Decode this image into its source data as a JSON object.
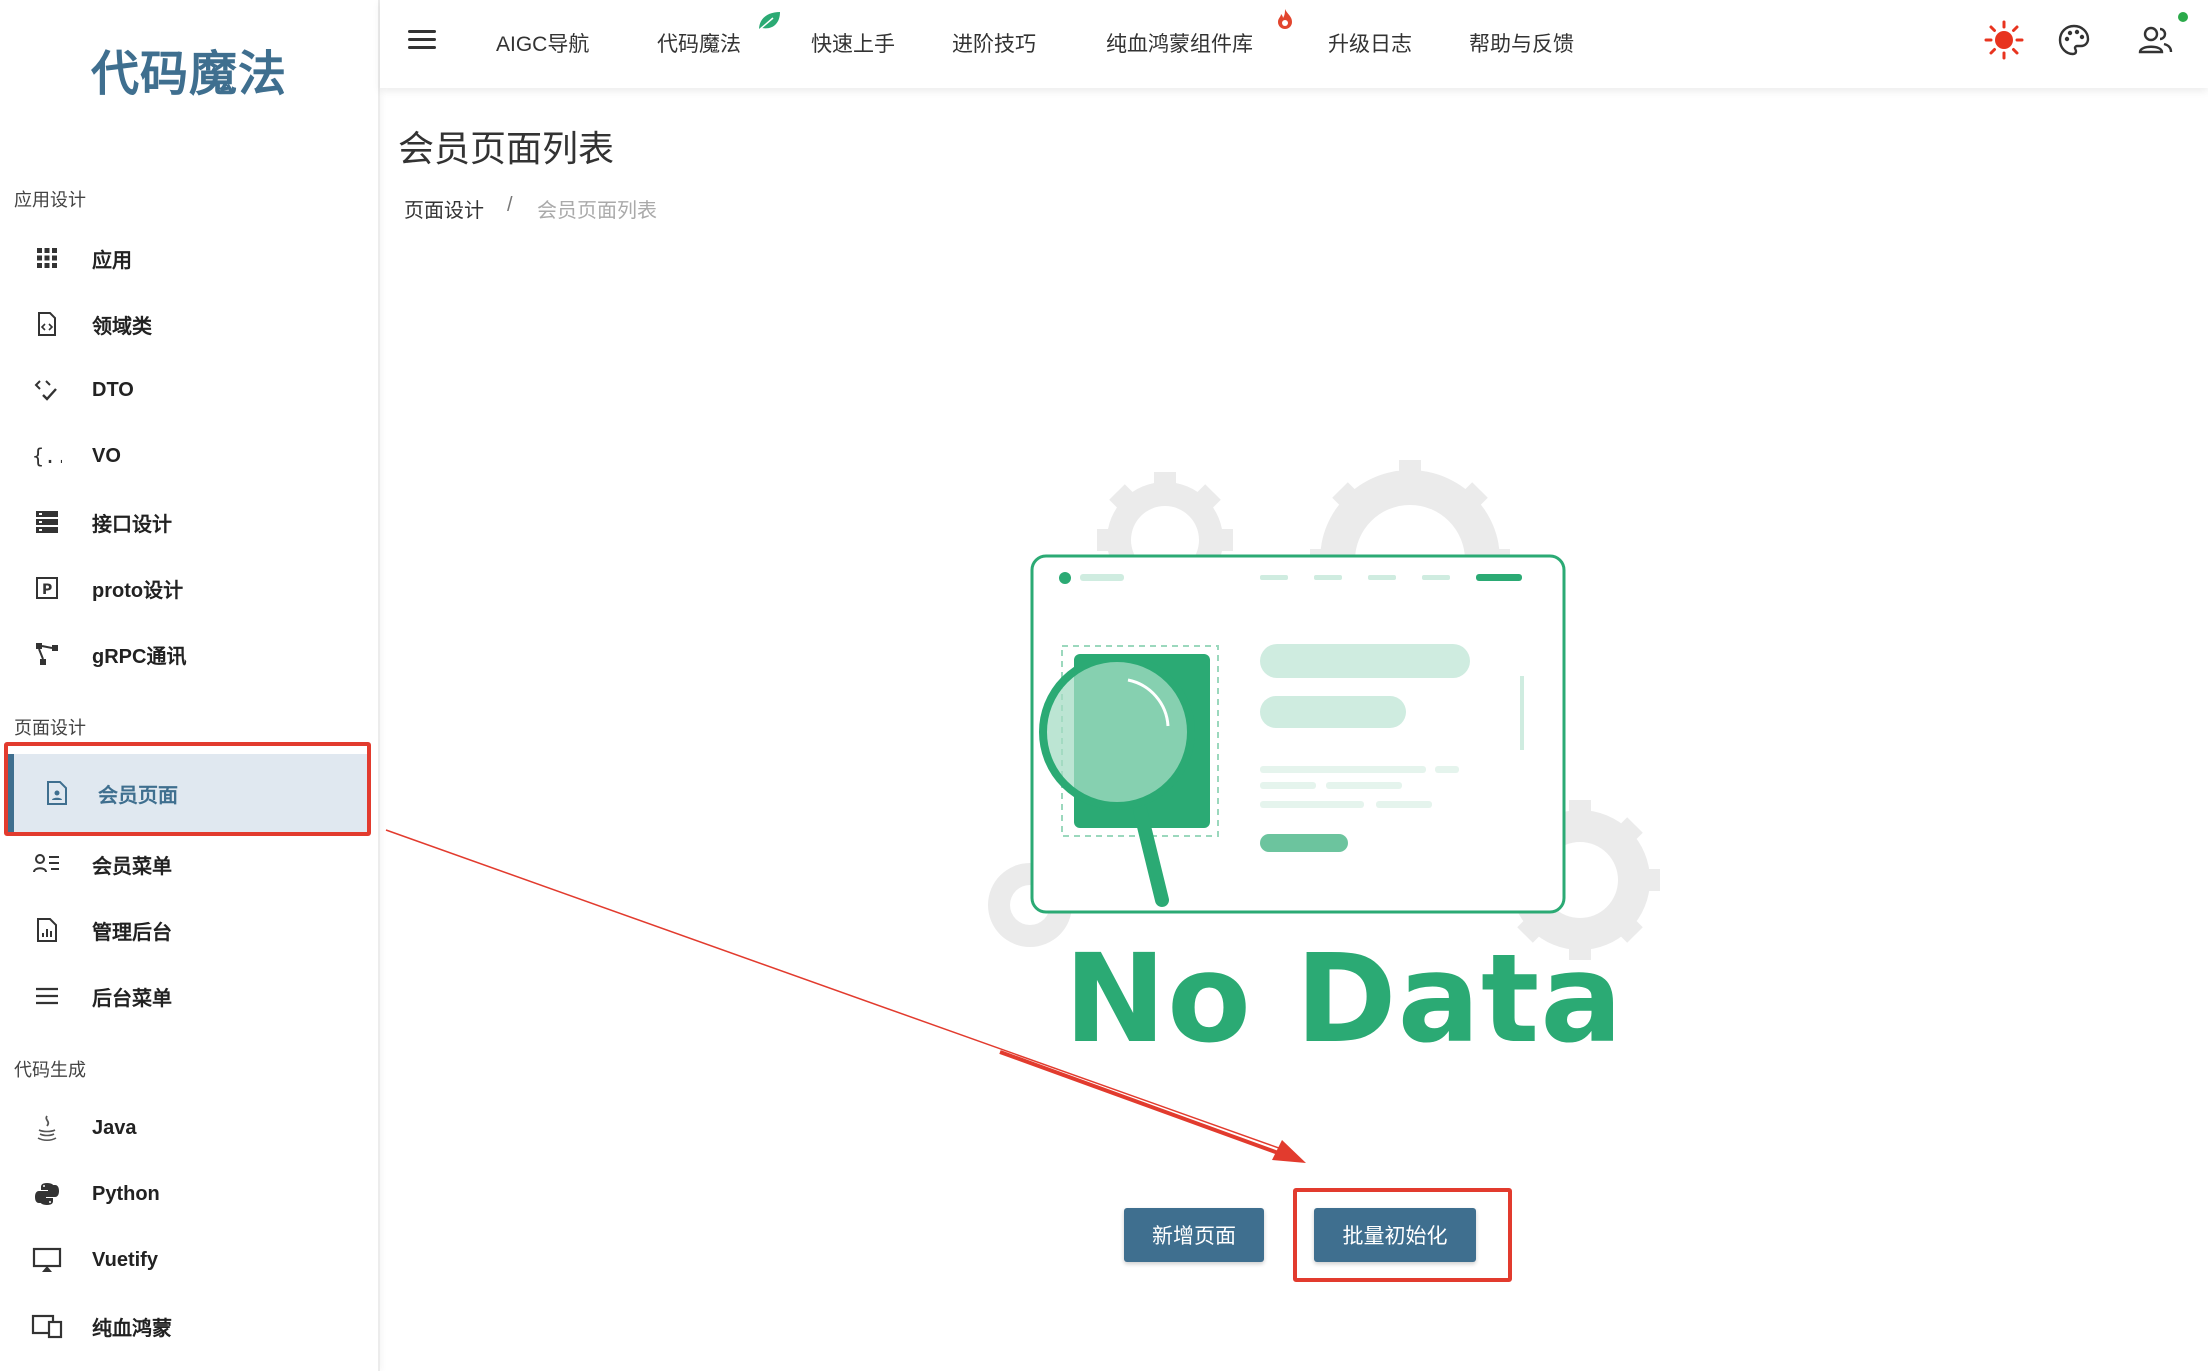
{
  "app": {
    "logo": "代码魔法"
  },
  "sidebar": {
    "sections": [
      {
        "title": "应用设计",
        "items": [
          {
            "label": "应用",
            "icon": "apps-grid-icon"
          },
          {
            "label": "领域类",
            "icon": "code-file-icon"
          },
          {
            "label": "DTO",
            "icon": "code-check-icon"
          },
          {
            "label": "VO",
            "icon": "braces-icon"
          },
          {
            "label": "接口设计",
            "icon": "server-icon"
          },
          {
            "label": "proto设计",
            "icon": "p-box-icon"
          },
          {
            "label": "gRPC通讯",
            "icon": "connection-icon"
          }
        ]
      },
      {
        "title": "页面设计",
        "items": [
          {
            "label": "会员页面",
            "icon": "user-page-icon",
            "active": true
          },
          {
            "label": "会员菜单",
            "icon": "user-list-icon"
          },
          {
            "label": "管理后台",
            "icon": "report-file-icon"
          },
          {
            "label": "后台菜单",
            "icon": "menu-lines-icon"
          }
        ]
      },
      {
        "title": "代码生成",
        "items": [
          {
            "label": "Java",
            "icon": "java-icon"
          },
          {
            "label": "Python",
            "icon": "python-icon"
          },
          {
            "label": "Vuetify",
            "icon": "monitor-icon"
          },
          {
            "label": "纯血鸿蒙",
            "icon": "devices-icon"
          }
        ]
      }
    ]
  },
  "topbar": {
    "nav": [
      "AIGC导航",
      "代码魔法",
      "快速上手",
      "进阶技巧",
      "纯血鸿蒙组件库",
      "升级日志",
      "帮助与反馈"
    ],
    "badges": {
      "代码魔法": "leaf-icon",
      "纯血鸿蒙组件库": "fire-icon"
    },
    "icons": [
      "sun-icon",
      "palette-icon",
      "users-icon"
    ]
  },
  "main": {
    "title": "会员页面列表",
    "breadcrumb": {
      "parent": "页面设计",
      "separator": "/",
      "current": "会员页面列表"
    },
    "empty_text": "No Data",
    "buttons": {
      "add": "新增页面",
      "batch_init": "批量初始化"
    }
  },
  "colors": {
    "primary": "#3f6f8f",
    "accent_green": "#2baa74",
    "annotation_red": "#e23b2e"
  }
}
